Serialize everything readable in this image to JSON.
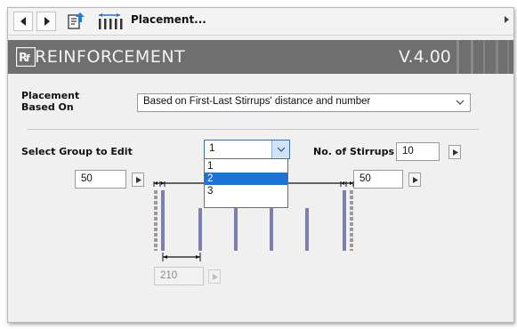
{
  "toolbar": {
    "title": "Placement...",
    "icons": [
      "back-arrow-icon",
      "forward-arrow-icon",
      "export-settings-icon",
      "stirrups-placement-icon",
      "more-arrow-icon"
    ]
  },
  "banner": {
    "title": "REINFORCEMENT",
    "version": "V.4.00",
    "logo_icon": "rf-logo-icon"
  },
  "placement": {
    "label": "Placement\nBased On",
    "selected": "Based on First-Last Stirrups' distance and number"
  },
  "group": {
    "label": "Select Group to Edit",
    "selected": "1",
    "options": [
      "1",
      "2",
      "3"
    ],
    "highlighted": "2"
  },
  "stirrups": {
    "label": "No. of Stirrups",
    "value": "10"
  },
  "first_distance": {
    "value": "50"
  },
  "last_distance": {
    "value": "50"
  },
  "spacing": {
    "value": "210",
    "enabled": false
  },
  "colors": {
    "banner": "#6f6f6f",
    "selection": "#1a73d9",
    "stirrup": "#7d7fb4"
  }
}
